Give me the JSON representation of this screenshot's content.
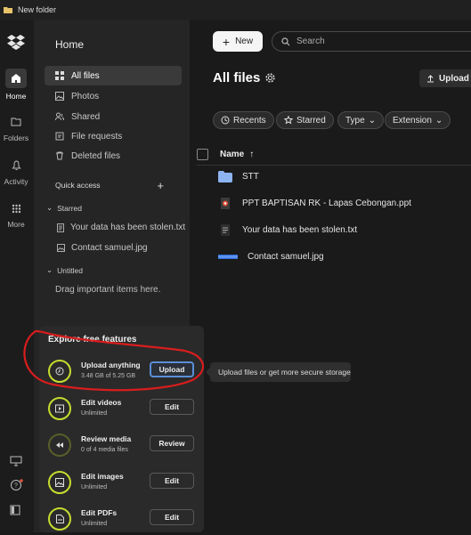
{
  "window": {
    "title": "New folder"
  },
  "rail": {
    "items": [
      {
        "label": "Home",
        "icon": "home-icon"
      },
      {
        "label": "Folders",
        "icon": "folder-icon"
      },
      {
        "label": "Activity",
        "icon": "bell-icon"
      },
      {
        "label": "More",
        "icon": "grid-icon"
      }
    ]
  },
  "sidebar": {
    "title": "Home",
    "nav": [
      {
        "label": "All files",
        "icon": "files-icon"
      },
      {
        "label": "Photos",
        "icon": "photos-icon"
      },
      {
        "label": "Shared",
        "icon": "shared-icon"
      },
      {
        "label": "File requests",
        "icon": "file-requests-icon"
      },
      {
        "label": "Deleted files",
        "icon": "trash-icon"
      }
    ],
    "quick_access": "Quick access",
    "starred_label": "Starred",
    "starred": [
      "Your data has been stolen.txt",
      "Contact samuel.jpg"
    ],
    "untitled_label": "Untitled",
    "untitled_hint": "Drag important items here."
  },
  "main": {
    "new_label": "New",
    "search_placeholder": "Search",
    "title": "All files",
    "upload_label": "Upload",
    "chips": [
      "Recents",
      "Starred",
      "Type",
      "Extension"
    ],
    "column_name": "Name",
    "files": [
      {
        "name": "STT",
        "type": "folder"
      },
      {
        "name": "PPT BAPTISAN RK - Lapas Cebongan.ppt",
        "type": "ppt"
      },
      {
        "name": "Your data has been stolen.txt",
        "type": "txt"
      },
      {
        "name": "Contact samuel.jpg",
        "type": "jpg"
      }
    ]
  },
  "explore": {
    "title": "Explore free features",
    "features": [
      {
        "name": "Upload anything",
        "detail": "3.48 GB of 5.25 GB",
        "button": "Upload",
        "progress": 0.66
      },
      {
        "name": "Edit videos",
        "detail": "Unlimited",
        "button": "Edit"
      },
      {
        "name": "Review media",
        "detail": "0 of 4 media files",
        "button": "Review"
      },
      {
        "name": "Edit images",
        "detail": "Unlimited",
        "button": "Edit"
      },
      {
        "name": "Edit PDFs",
        "detail": "Unlimited",
        "button": "Edit"
      }
    ]
  },
  "tooltip": "Upload files or get more secure storage",
  "colors": {
    "accent_ring": "#c6dd2f",
    "annotation": "#d81d1d",
    "primary_border": "#5a8fd8"
  }
}
